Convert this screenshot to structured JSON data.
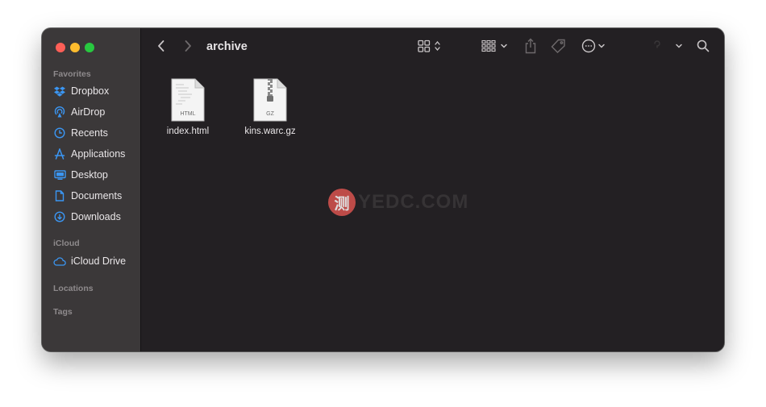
{
  "window": {
    "title": "archive"
  },
  "sidebar": {
    "sections": [
      {
        "title": "Favorites",
        "items": [
          {
            "label": "Dropbox",
            "icon": "dropbox-icon"
          },
          {
            "label": "AirDrop",
            "icon": "airdrop-icon"
          },
          {
            "label": "Recents",
            "icon": "clock-icon"
          },
          {
            "label": "Applications",
            "icon": "applications-icon"
          },
          {
            "label": "Desktop",
            "icon": "desktop-icon"
          },
          {
            "label": "Documents",
            "icon": "document-icon"
          },
          {
            "label": "Downloads",
            "icon": "download-icon"
          }
        ]
      },
      {
        "title": "iCloud",
        "items": [
          {
            "label": "iCloud Drive",
            "icon": "cloud-icon"
          }
        ]
      },
      {
        "title": "Locations",
        "items": []
      },
      {
        "title": "Tags",
        "items": []
      }
    ]
  },
  "files": [
    {
      "name": "index.html",
      "type_label": "HTML"
    },
    {
      "name": "kins.warc.gz",
      "type_label": "GZ"
    }
  ],
  "watermark": {
    "badge": "测",
    "text": "YEDC.COM"
  },
  "colors": {
    "accent": "#3b96f3",
    "sidebar_bg": "#3b3839",
    "content_bg": "#232023"
  }
}
